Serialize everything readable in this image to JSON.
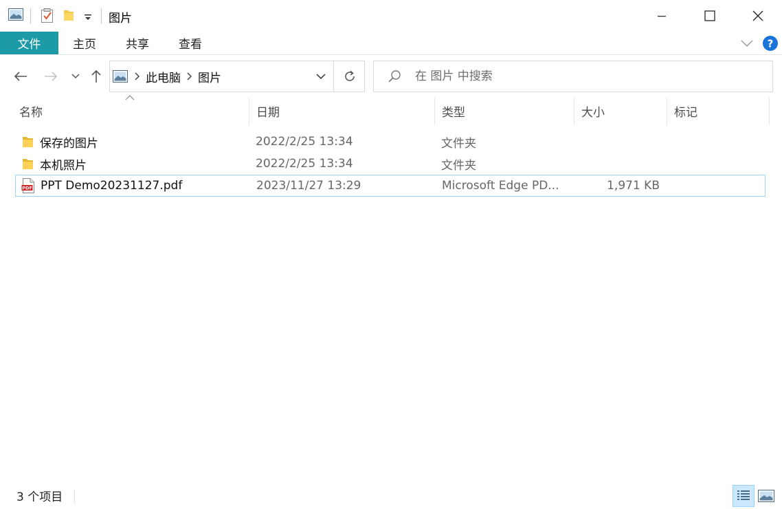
{
  "window": {
    "title": "图片"
  },
  "ribbon": {
    "tabs": [
      {
        "label": "文件"
      },
      {
        "label": "主页"
      },
      {
        "label": "共享"
      },
      {
        "label": "查看"
      }
    ],
    "help_label": "?"
  },
  "nav": {
    "breadcrumb": [
      "此电脑",
      "图片"
    ]
  },
  "search": {
    "placeholder": "在 图片 中搜索"
  },
  "columns": [
    {
      "label": "名称"
    },
    {
      "label": "日期"
    },
    {
      "label": "类型"
    },
    {
      "label": "大小"
    },
    {
      "label": "标记"
    }
  ],
  "files": [
    {
      "name": "保存的图片",
      "date": "2022/2/25 13:34",
      "type": "文件夹",
      "size": "",
      "icon": "folder-icon"
    },
    {
      "name": "本机照片",
      "date": "2022/2/25 13:34",
      "type": "文件夹",
      "size": "",
      "icon": "folder-icon"
    },
    {
      "name": "PPT Demo20231127.pdf",
      "date": "2023/11/27 13:29",
      "type": "Microsoft Edge PD...",
      "size": "1,971 KB",
      "icon": "pdf-file-icon",
      "selected": true
    }
  ],
  "status": {
    "item_count": "3 个项目"
  },
  "colors": {
    "accent": "#1c9aa6",
    "selection_border": "#99d1ff",
    "help_blue": "#1a73d9"
  }
}
